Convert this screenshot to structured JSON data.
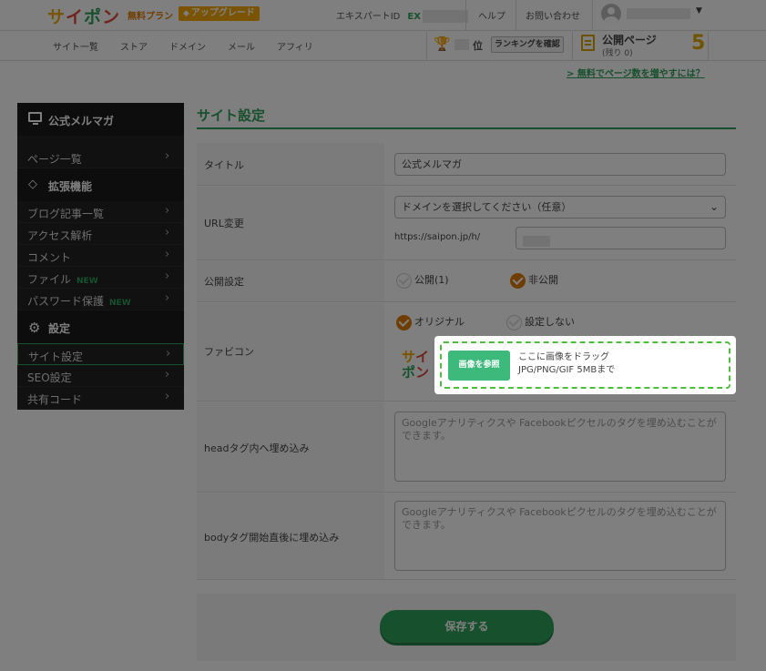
{
  "header": {
    "logo": [
      "サ",
      "イ",
      "ポ",
      "ン"
    ],
    "plan_label": "無料プラン",
    "upgrade_label": "アップグレード",
    "expert_label": "エキスパートID",
    "expert_prefix": "EX",
    "help_link": "ヘルプ",
    "contact_link": "お問い合わせ"
  },
  "nav": {
    "items": [
      "サイト一覧",
      "ストア",
      "ドメイン",
      "メール",
      "アフィリ"
    ],
    "rank_suffix": "位",
    "rank_button": "ランキングを確認",
    "published_label": "公開ページ",
    "remaining_label": "(残り 0)",
    "published_count": "5",
    "more_pages_link": "> 無料でページ数を増やすには？"
  },
  "sidebar": {
    "site_name": "公式メルマガ",
    "group1": [
      {
        "label": "ページ一覧",
        "new": ""
      }
    ],
    "ext_title": "拡張機能",
    "group2": [
      {
        "label": "ブログ記事一覧",
        "new": ""
      },
      {
        "label": "アクセス解析",
        "new": ""
      },
      {
        "label": "コメント",
        "new": ""
      },
      {
        "label": "ファイル",
        "new": "NEW"
      },
      {
        "label": "パスワード保護",
        "new": "NEW"
      }
    ],
    "settings_title": "設定",
    "group3": [
      {
        "label": "サイト設定",
        "new": ""
      },
      {
        "label": "SEO設定",
        "new": ""
      },
      {
        "label": "共有コード",
        "new": ""
      }
    ]
  },
  "main": {
    "section_title": "サイト設定",
    "title_row": {
      "label": "タイトル",
      "value": "公式メルマガ"
    },
    "url_row": {
      "label": "URL変更",
      "select_value": "ドメインを選択してください（任意）",
      "prefix": "https://saipon.jp/h/"
    },
    "publish_row": {
      "label": "公開設定",
      "option_public": "公開(1)",
      "option_private": "非公開"
    },
    "favicon_row": {
      "label": "ファビコン",
      "option_original": "オリジナル",
      "option_none": "設定しない",
      "preview": [
        "サ",
        "イ",
        "ポ",
        "ン"
      ]
    },
    "head_row": {
      "label": "headタグ内へ埋め込み",
      "placeholder": "Googleアナリティクスや Facebookピクセルのタグを埋め込むことができます。"
    },
    "body_row": {
      "label": "bodyタグ開始直後に埋め込み",
      "placeholder": "Googleアナリティクスや Facebookピクセルのタグを埋め込むことができます。"
    },
    "save_button": "保存する"
  },
  "upload": {
    "browse_button": "画像を参照",
    "drop_line1": "ここに画像をドラッグ",
    "drop_line2": "JPG/PNG/GIF 5MBまで"
  },
  "colors": {
    "accent": "#2fa05a",
    "orange": "#e07b00",
    "logo_gold": "#f4a800",
    "overlay": "rgba(0,0,0,0.5)"
  }
}
